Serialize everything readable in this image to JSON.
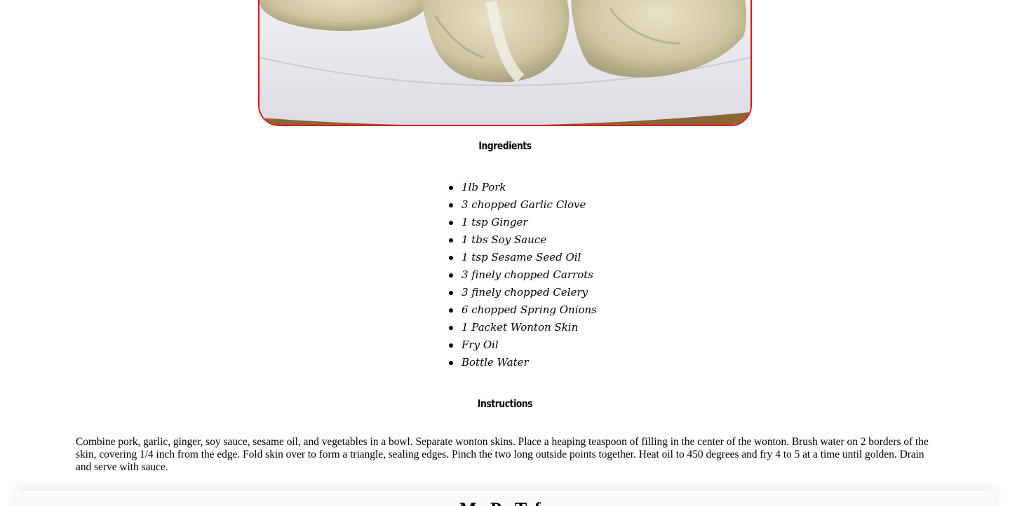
{
  "recipe": {
    "image_alt": "steamed wontons on a white plate",
    "ingredients_heading": "Ingredients",
    "ingredients": [
      "1lb Pork",
      "3 chopped Garlic Clove",
      "1 tsp Ginger",
      "1 tbs Soy Sauce",
      "1 tsp Sesame Seed Oil",
      "3 finely chopped Carrots",
      "3 finely chopped Celery",
      "6 chopped Spring Onions",
      "1 Packet Wonton Skin",
      "Fry Oil",
      "Bottle Water"
    ],
    "instructions_heading": "Instructions",
    "instructions": "Combine pork, garlic, ginger, soy sauce, sesame oil, and vegetables in a bowl. Separate wonton skins. Place a heaping teaspoon of filling in the center of the wonton. Brush water on 2 borders of the skin, covering 1/4 inch from the edge. Fold skin over to form a triangle, sealing edges. Pinch the two long outside points together. Heat oil to 450 degrees and fry 4 to 5 at a time until golden. Drain and serve with sauce."
  },
  "next_card": {
    "title": "Ma Po Tofu"
  },
  "colors": {
    "photo_border": "#e3141b",
    "text": "#000000",
    "background": "#ffffff"
  }
}
